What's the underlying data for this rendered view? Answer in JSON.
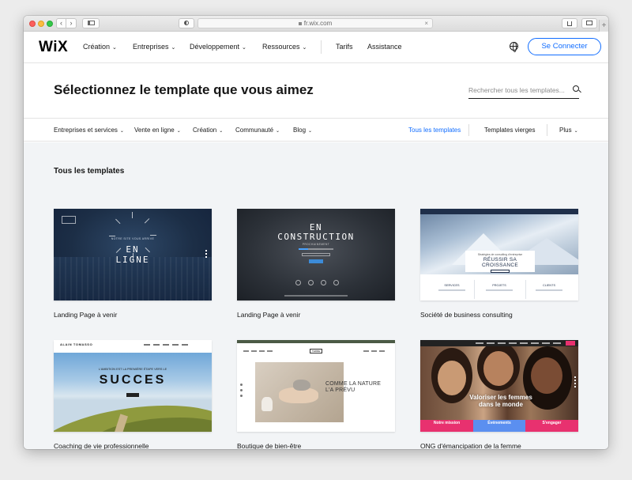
{
  "browser": {
    "address": "fr.wix.com",
    "back_icon": "‹",
    "forward_icon": "›",
    "plus_icon": "+"
  },
  "header": {
    "logo": "WiX",
    "nav": [
      "Création",
      "Entreprises",
      "Développement",
      "Ressources"
    ],
    "links": [
      "Tarifs",
      "Assistance"
    ],
    "connect_label": "Se Connecter"
  },
  "hero": {
    "title": "Sélectionnez le template que vous aimez",
    "search_placeholder": "Rechercher tous les templates..."
  },
  "categories": {
    "items": [
      "Entreprises et services",
      "Vente en ligne",
      "Création",
      "Communauté",
      "Blog"
    ],
    "all_templates": "Tous les templates",
    "blank_templates": "Templates vierges",
    "more": "Plus"
  },
  "gallery": {
    "title": "Tous les templates",
    "cards": [
      {
        "caption": "Landing Page à venir",
        "big1": "EN",
        "big2": "LIGNE",
        "small": "NOTRE SITE VOUS ARRIVE"
      },
      {
        "caption": "Landing Page à venir",
        "big1": "EN",
        "big2": "CONSTRUCTION",
        "small": "PROCHAINEMENT"
      },
      {
        "caption": "Société de business consulting",
        "panel_small": "Stratégies de consulting d'entreprise",
        "panel_title": "RÉUSSIR SA CROISSANCE",
        "cols": [
          "SERVICES",
          "PROJETS",
          "CLIENTS"
        ]
      },
      {
        "caption": "Coaching de vie professionnelle",
        "name": "ALAIN TOMASSO",
        "sub": "L'AMBITION EST LA PREMIÈRE ÉTAPE VERS LE",
        "big": "SUCCES"
      },
      {
        "caption": "Boutique de bien-être",
        "logo": "TERRE",
        "text1": "COMME LA NATURE",
        "text2": "L'A PRÉVU"
      },
      {
        "caption": "ONG d'émancipation de la femme",
        "overlay1": "Valoriser les femmes",
        "overlay2": "dans le monde",
        "boxes": [
          "Notre mission",
          "Événements",
          "S'engager"
        ]
      }
    ]
  }
}
